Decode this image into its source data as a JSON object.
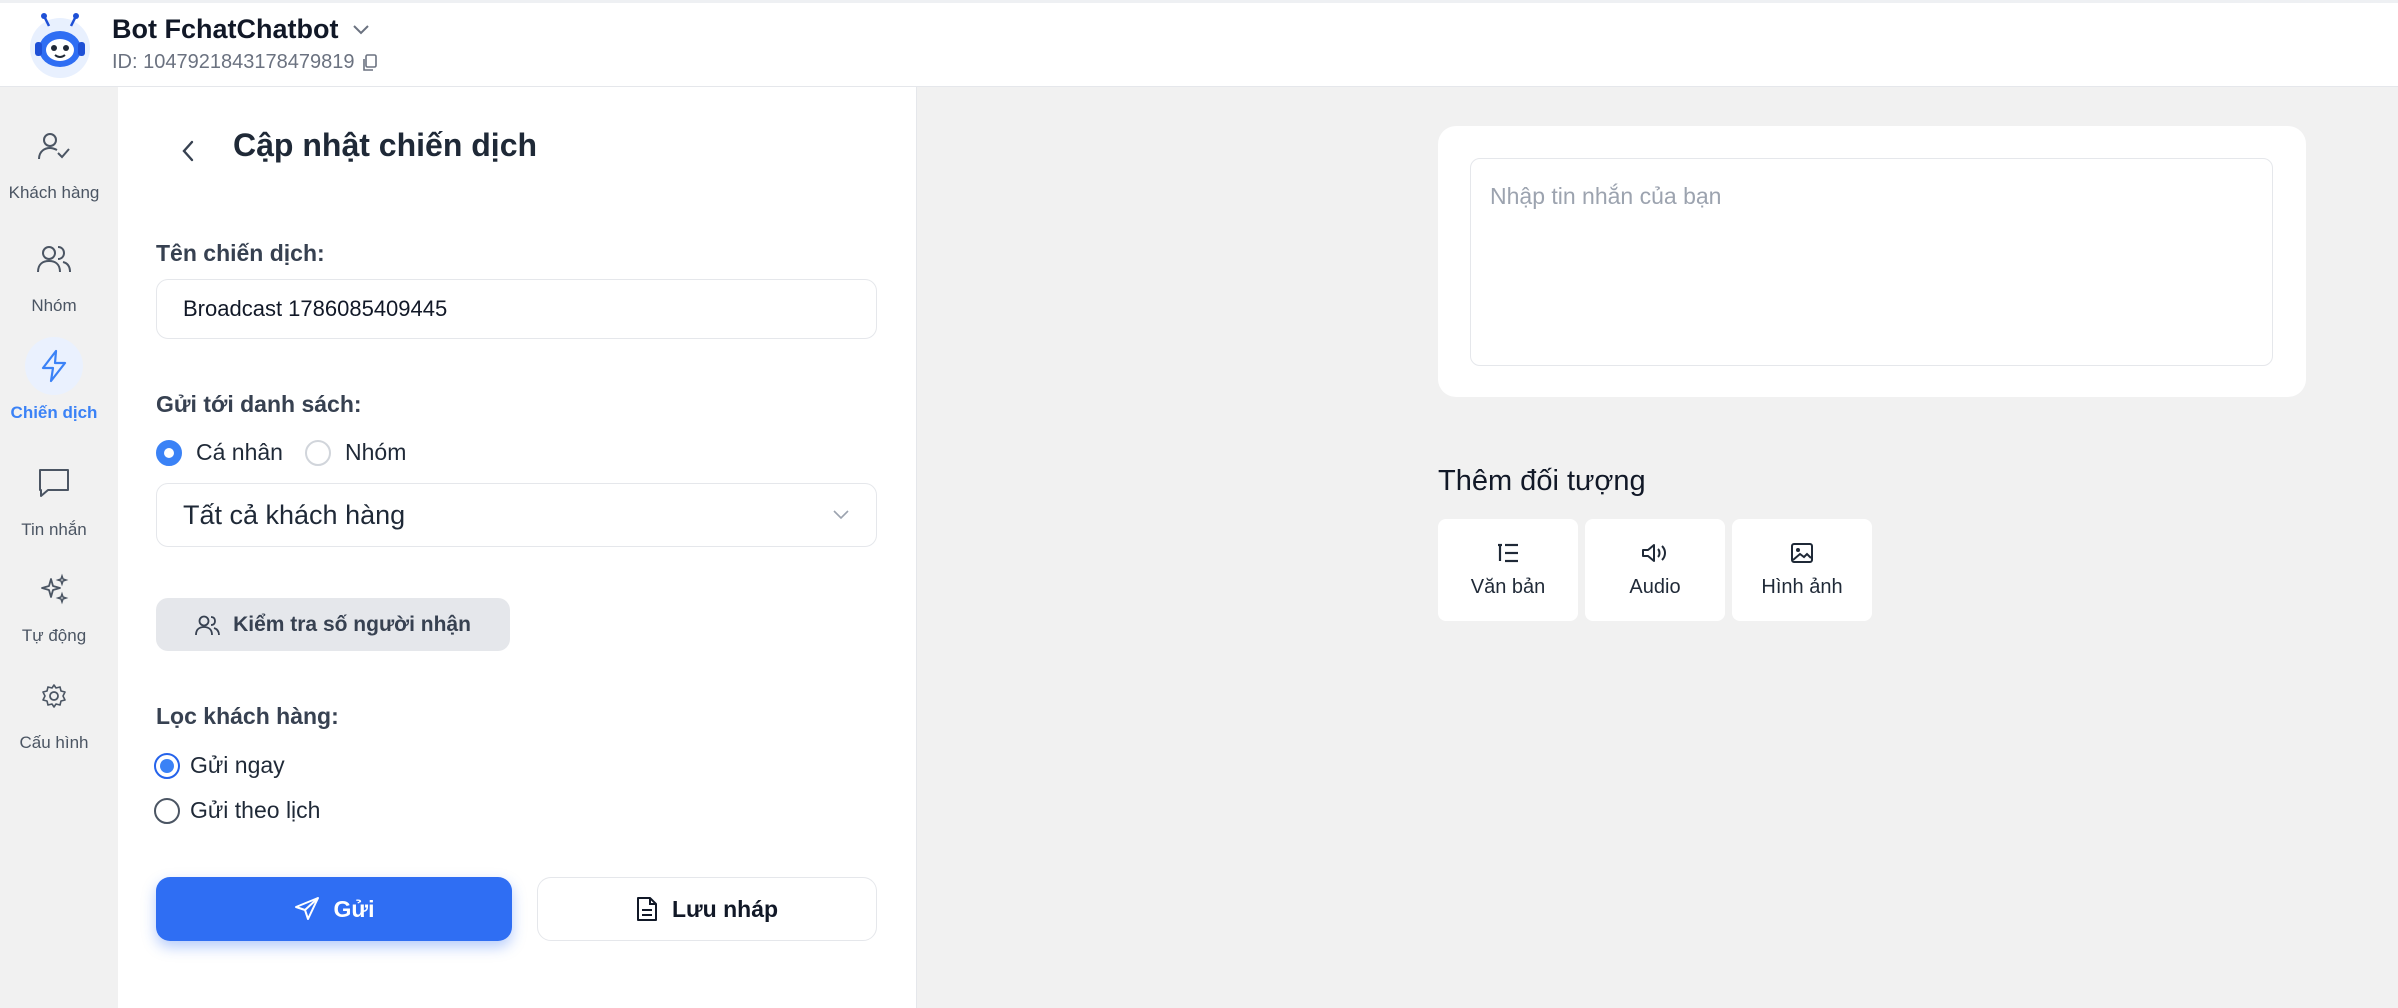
{
  "header": {
    "bot_name": "Bot FchatChatbot",
    "bot_id": "ID: 1047921843178479819"
  },
  "sidenav": {
    "items": [
      {
        "label": "Khách hàng",
        "icon": "user-check-icon",
        "active": false
      },
      {
        "label": "Nhóm",
        "icon": "users-icon",
        "active": false
      },
      {
        "label": "Chiến dịch",
        "icon": "lightning-icon",
        "active": true
      },
      {
        "label": "Tin nhắn",
        "icon": "message-square-icon",
        "active": false
      },
      {
        "label": "Tự động",
        "icon": "sparkles-icon",
        "active": false
      },
      {
        "label": "Cấu hình",
        "icon": "gear-icon",
        "active": false
      }
    ]
  },
  "panel": {
    "title": "Cập nhật chiến dịch",
    "campaign_name_label": "Tên chiến dịch:",
    "campaign_name_value": "Broadcast 1786085409445",
    "send_to_label": "Gửi tới danh sách:",
    "recipient_type_options": [
      "Cá nhân",
      "Nhóm"
    ],
    "recipient_type_selected": "Cá nhân",
    "list_selected": "Tất cả khách hàng",
    "check_recipients_label": "Kiểm tra số người nhận",
    "filter_label": "Lọc khách hàng:",
    "schedule_options": [
      "Gửi ngay",
      "Gửi theo lịch"
    ],
    "schedule_selected": "Gửi ngay",
    "send_label": "Gửi",
    "draft_label": "Lưu nháp"
  },
  "editor": {
    "message_placeholder": "Nhập tin nhắn của bạn",
    "message_value": "",
    "add_object_title": "Thêm đối tượng",
    "object_buttons": [
      {
        "label": "Văn bản",
        "icon": "text-list-icon"
      },
      {
        "label": "Audio",
        "icon": "speaker-icon"
      },
      {
        "label": "Hình ảnh",
        "icon": "image-icon"
      }
    ]
  },
  "colors": {
    "accent": "#2f6ef3",
    "active_nav": "#3b82f6",
    "background": "#f1f1f1"
  }
}
